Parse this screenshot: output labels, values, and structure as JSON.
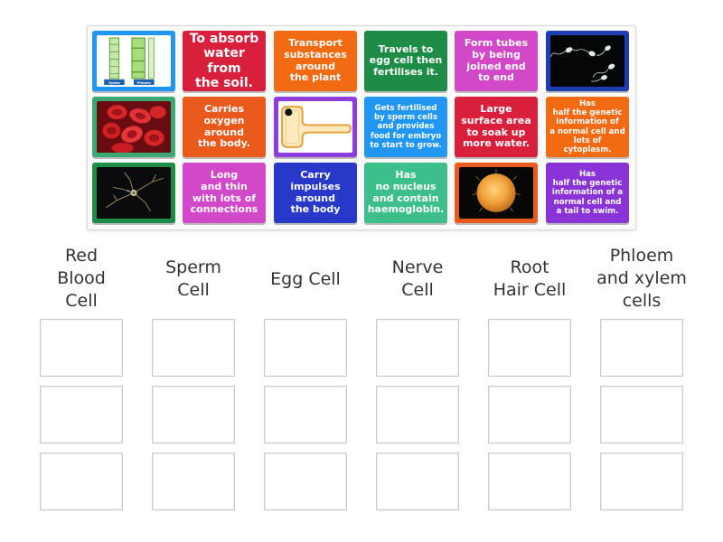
{
  "colors": {
    "blue": "#2196f3",
    "red": "#d81f3c",
    "orange": "#f26a12",
    "green": "#1d8c46",
    "pink": "#d149c9",
    "navy": "#1f3db3",
    "teal": "#3aa973",
    "deep_orange": "#e95a1c",
    "purple": "#8f3ddc",
    "royal": "#2838c8",
    "mint": "#3cbf8a",
    "violet": "#8a33d6"
  },
  "cards": [
    {
      "kind": "image",
      "icon": "xylem-phloem-image",
      "color": "blue",
      "label_left": "Xylem",
      "label_right": "Phloem"
    },
    {
      "kind": "text",
      "color": "red",
      "text": "To absorb\nwater from\nthe soil."
    },
    {
      "kind": "text",
      "color": "orange",
      "text": "Transport\nsubstances\naround\nthe plant"
    },
    {
      "kind": "text",
      "color": "green",
      "text": "Travels to\negg cell then\nfertilises it."
    },
    {
      "kind": "text",
      "color": "pink",
      "text": "Form tubes\nby being\njoined end\nto end"
    },
    {
      "kind": "image",
      "icon": "sperm-cells-image",
      "color": "navy"
    },
    {
      "kind": "image",
      "icon": "red-blood-cells-image",
      "color": "teal"
    },
    {
      "kind": "text",
      "color": "deep_orange",
      "text": "Carries\noxygen\naround\nthe body."
    },
    {
      "kind": "image",
      "icon": "root-hair-cell-image",
      "color": "purple"
    },
    {
      "kind": "text",
      "color": "blue",
      "text": "Gets fertilised\nby sperm cells\nand provides\nfood for embryo\nto start to grow."
    },
    {
      "kind": "text",
      "color": "red",
      "text": "Large\nsurface area\nto soak up\nmore water."
    },
    {
      "kind": "text",
      "color": "orange",
      "text": "Has\nhalf the genetic\ninformation of\na normal cell and\nlots of cytoplasm."
    },
    {
      "kind": "image",
      "icon": "nerve-cell-image",
      "color": "green"
    },
    {
      "kind": "text",
      "color": "pink",
      "text": "Long\nand thin\nwith lots of\nconnections"
    },
    {
      "kind": "text",
      "color": "royal",
      "text": "Carry\nimpulses\naround\nthe body"
    },
    {
      "kind": "text",
      "color": "mint",
      "text": "Has\nno nucleus\nand contain\nhaemoglobin."
    },
    {
      "kind": "image",
      "icon": "egg-cell-image",
      "color": "deep_orange"
    },
    {
      "kind": "text",
      "color": "violet",
      "text": "Has\nhalf the genetic\ninformation of a\nnormal cell and\na tail to swim."
    }
  ],
  "categories": [
    {
      "heading": "Red\nBlood\nCell"
    },
    {
      "heading": "Sperm\nCell"
    },
    {
      "heading": "Egg Cell"
    },
    {
      "heading": "Nerve\nCell"
    },
    {
      "heading": "Root\nHair Cell"
    },
    {
      "heading": "Phloem\nand xylem\ncells"
    }
  ]
}
